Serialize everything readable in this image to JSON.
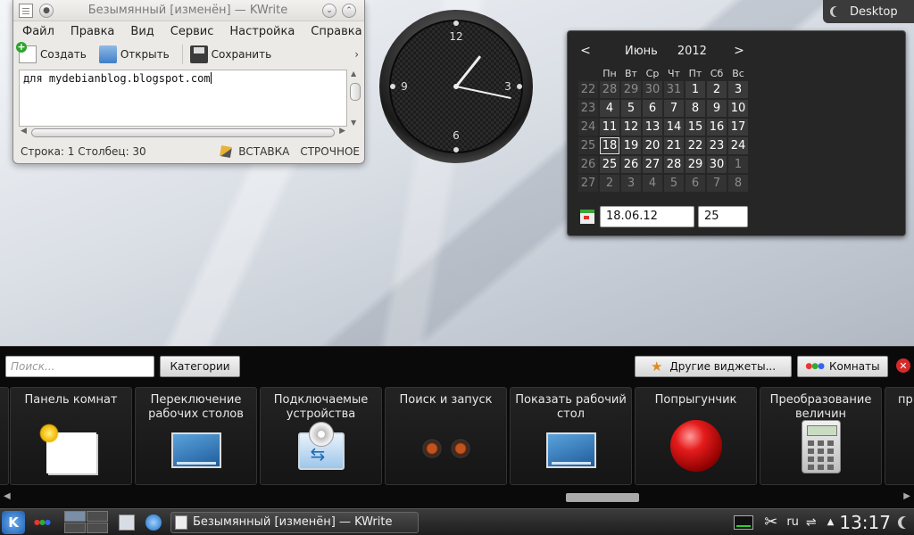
{
  "kwrite": {
    "title": "Безымянный [изменён] — KWrite",
    "menu": [
      "Файл",
      "Правка",
      "Вид",
      "Сервис",
      "Настройка",
      "Справка"
    ],
    "toolbar": {
      "new": "Создать",
      "open": "Открыть",
      "save": "Сохранить",
      "more": "›"
    },
    "text": "для mydebianblog.blogspot.com",
    "status": {
      "position": "Строка: 1 Столбец: 30",
      "insert": "ВСТАВКА",
      "mode": "СТРОЧНОЕ"
    }
  },
  "clock": {
    "time": "13:17",
    "numerals": [
      "12",
      "3",
      "6",
      "9"
    ]
  },
  "calendar": {
    "prev": "<",
    "next": ">",
    "month": "Июнь",
    "year": "2012",
    "weekdays": [
      "Пн",
      "Вт",
      "Ср",
      "Чт",
      "Пт",
      "Сб",
      "Вс"
    ],
    "weeks": [
      {
        "num": "22",
        "days": [
          {
            "d": "28",
            "o": true
          },
          {
            "d": "29",
            "o": true
          },
          {
            "d": "30",
            "o": true
          },
          {
            "d": "31",
            "o": true
          },
          {
            "d": "1"
          },
          {
            "d": "2"
          },
          {
            "d": "3"
          }
        ]
      },
      {
        "num": "23",
        "days": [
          {
            "d": "4"
          },
          {
            "d": "5"
          },
          {
            "d": "6"
          },
          {
            "d": "7"
          },
          {
            "d": "8"
          },
          {
            "d": "9"
          },
          {
            "d": "10"
          }
        ]
      },
      {
        "num": "24",
        "days": [
          {
            "d": "11"
          },
          {
            "d": "12"
          },
          {
            "d": "13"
          },
          {
            "d": "14"
          },
          {
            "d": "15"
          },
          {
            "d": "16"
          },
          {
            "d": "17"
          }
        ]
      },
      {
        "num": "25",
        "days": [
          {
            "d": "18",
            "today": true
          },
          {
            "d": "19"
          },
          {
            "d": "20"
          },
          {
            "d": "21"
          },
          {
            "d": "22"
          },
          {
            "d": "23"
          },
          {
            "d": "24"
          }
        ]
      },
      {
        "num": "26",
        "days": [
          {
            "d": "25"
          },
          {
            "d": "26"
          },
          {
            "d": "27"
          },
          {
            "d": "28"
          },
          {
            "d": "29"
          },
          {
            "d": "30"
          },
          {
            "d": "1",
            "o": true
          }
        ]
      },
      {
        "num": "27",
        "days": [
          {
            "d": "2",
            "o": true
          },
          {
            "d": "3",
            "o": true
          },
          {
            "d": "4",
            "o": true
          },
          {
            "d": "5",
            "o": true
          },
          {
            "d": "6",
            "o": true
          },
          {
            "d": "7",
            "o": true
          },
          {
            "d": "8",
            "o": true
          }
        ]
      }
    ],
    "date_field": "18.06.12",
    "week_field": "25"
  },
  "desktop_toolbox": {
    "label": "Desktop"
  },
  "explorer": {
    "search_placeholder": "Поиск...",
    "categories": "Категории",
    "more_widgets": "Другие виджеты...",
    "rooms": "Комнаты",
    "widgets": [
      {
        "label": "Панель комнат",
        "icon": "rooms-panel-icon"
      },
      {
        "label": "Переключение рабочих столов",
        "icon": "pager-icon"
      },
      {
        "label": "Подключаемые устройства",
        "icon": "usb-device-icon"
      },
      {
        "label": "Поиск и запуск",
        "icon": "binoculars-icon"
      },
      {
        "label": "Показать рабочий стол",
        "icon": "show-desktop-icon"
      },
      {
        "label": "Попрыгунчик",
        "icon": "bouncy-ball-icon"
      },
      {
        "label": "Преобразование величин",
        "icon": "calculator-icon"
      },
      {
        "label": "пр",
        "icon": ""
      }
    ],
    "scroll_left": "◀",
    "scroll_right": "▶"
  },
  "taskbar": {
    "task_label": "Безымянный [изменён] — KWrite",
    "kmenu_letter": "K",
    "language": "ru",
    "clock": "13:17"
  }
}
